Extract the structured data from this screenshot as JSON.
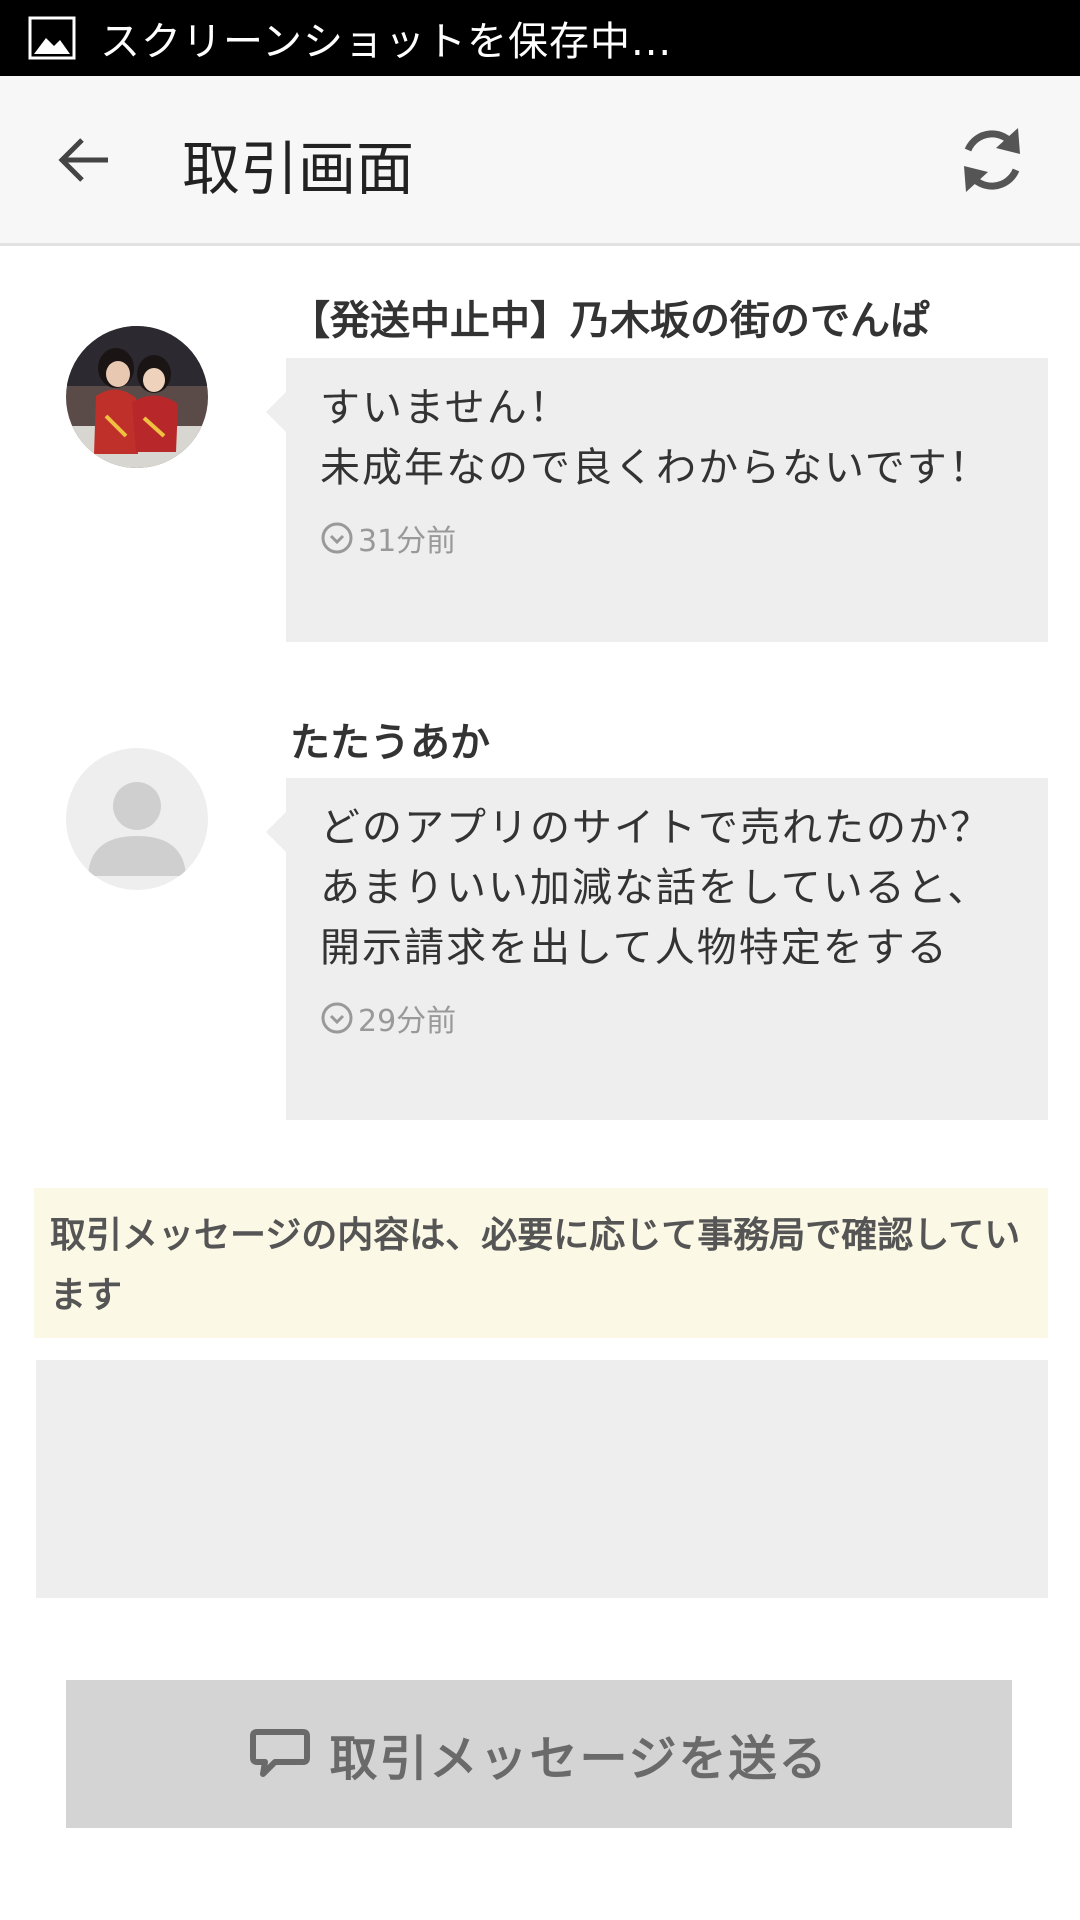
{
  "status_bar": {
    "text": "スクリーンショットを保存中..."
  },
  "app_bar": {
    "title": "取引画面"
  },
  "messages": [
    {
      "sender": "【発送中止中】乃木坂の街のでんぱ",
      "text": "すいません！\n未成年なので良くわからないです！",
      "time": "31分前"
    },
    {
      "sender": "たたうあか",
      "text": "どのアプリのサイトで売れたのか？あまりいい加減な話をしていると、開示請求を出して人物特定をする",
      "time": "29分前"
    }
  ],
  "notice": "取引メッセージの内容は、必要に応じて事務局で確認しています",
  "composer": {
    "value": ""
  },
  "send_button": {
    "label": "取引メッセージを送る"
  }
}
